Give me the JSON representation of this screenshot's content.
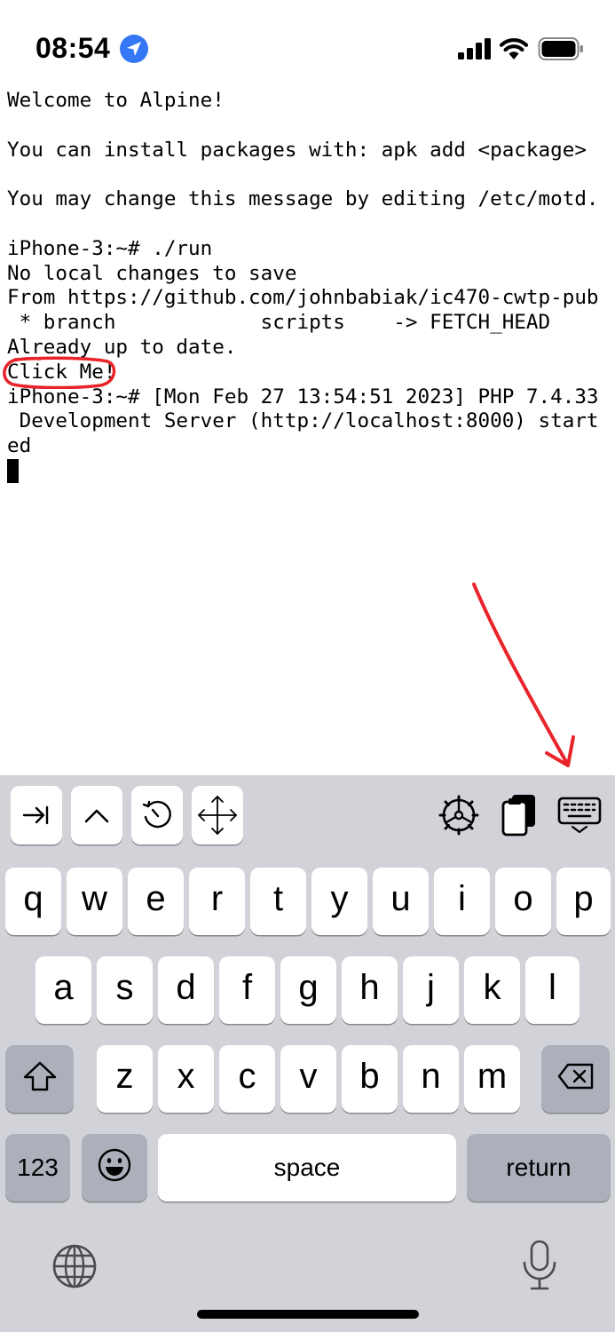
{
  "status_bar": {
    "time": "08:54",
    "icons": [
      "location-arrow-icon",
      "cellular-signal-icon",
      "wifi-icon",
      "battery-icon"
    ]
  },
  "terminal": {
    "lines": [
      "Welcome to Alpine!",
      "",
      "You can install packages with: apk add <package>",
      "",
      "You may change this message by editing /etc/motd.",
      "",
      "iPhone-3:~# ./run",
      "No local changes to save",
      "From https://github.com/johnbabiak/ic470-cwtp-pub",
      " * branch            scripts    -> FETCH_HEAD",
      "Already up to date.",
      "Click Me!",
      "iPhone-3:~# [Mon Feb 27 13:54:51 2023] PHP 7.4.33",
      " Development Server (http://localhost:8000) start",
      "ed"
    ]
  },
  "accessory_bar": {
    "left_buttons": [
      "tab-icon",
      "control-caret-icon",
      "history-icon",
      "move-arrows-icon"
    ],
    "right_buttons": [
      "settings-wheel-icon",
      "clipboard-icon",
      "keyboard-hide-icon"
    ]
  },
  "keyboard": {
    "row1": [
      "q",
      "w",
      "e",
      "r",
      "t",
      "y",
      "u",
      "i",
      "o",
      "p"
    ],
    "row2": [
      "a",
      "s",
      "d",
      "f",
      "g",
      "h",
      "j",
      "k",
      "l"
    ],
    "row3": [
      "z",
      "x",
      "c",
      "v",
      "b",
      "n",
      "m"
    ],
    "numbers_label": "123",
    "space_label": "space",
    "return_label": "return"
  },
  "colors": {
    "annotation_red": "#e8242a",
    "keyboard_bg": "#d1d3d9",
    "dark_key": "#abb0ba",
    "location_blue": "#3478f6"
  }
}
